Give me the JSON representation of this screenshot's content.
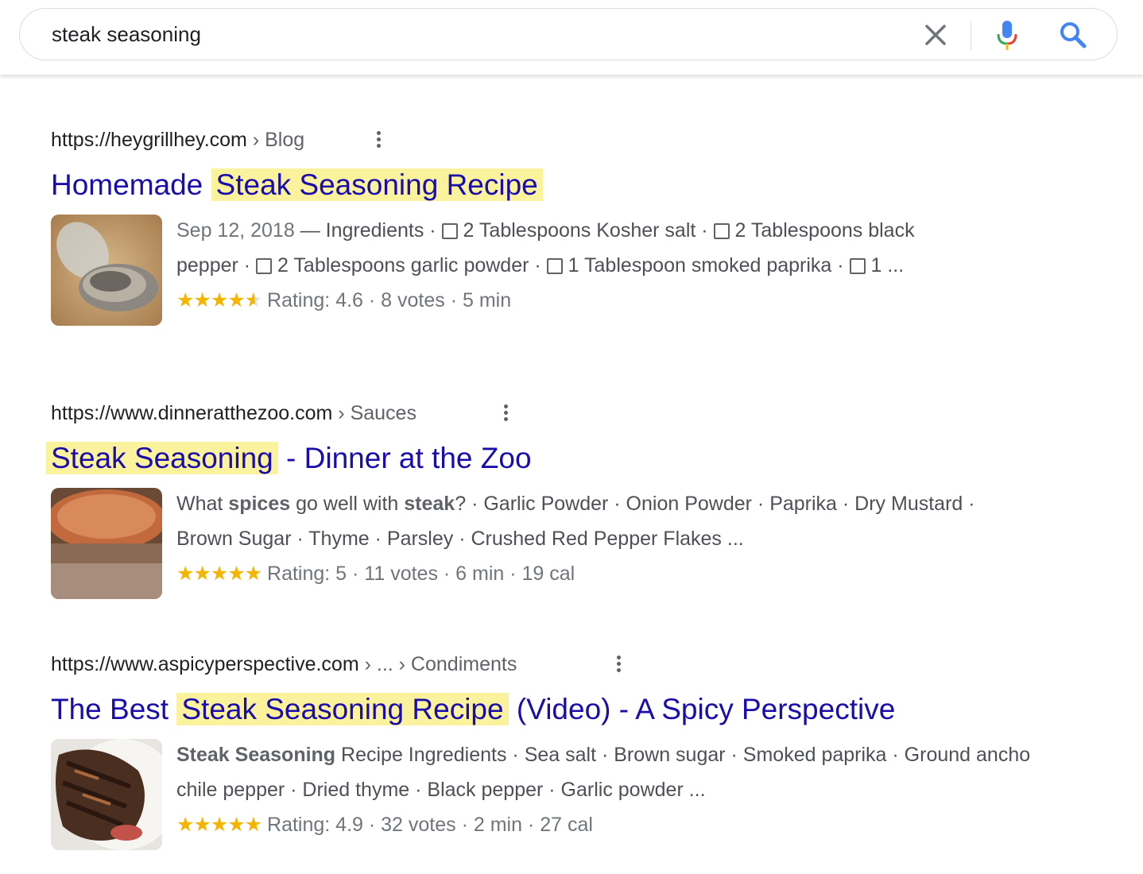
{
  "search": {
    "query": "steak seasoning"
  },
  "results": [
    {
      "url": "https://heygrillhey.com",
      "path": " › Blog",
      "title_pre": "Homemade ",
      "title_hl": "Steak Seasoning Recipe",
      "title_post": "",
      "snippet_line1": {
        "date": "Sep 12, 2018",
        "sep": " — ",
        "label": "Ingredients",
        "item1": "2 Tablespoons Kosher salt",
        "item2": "2 Tablespoons black"
      },
      "snippet_line2": {
        "item2_cont": "pepper",
        "item3": "2 Tablespoons garlic powder",
        "item4": "1 Tablespoon smoked paprika",
        "item5": "1 ..."
      },
      "stars": "★★★★",
      "star_partial": "★",
      "rating_text": "Rating: 4.6 · 8 votes · 5 min",
      "rating_value": 4.6
    },
    {
      "url": "https://www.dinneratthezoo.com",
      "path": " › Sauces",
      "title_pre": "",
      "title_hl": "Steak Seasoning",
      "title_post": " - Dinner at the Zoo",
      "snippet_a": "What ",
      "snippet_b1": "spices",
      "snippet_c": " go well with ",
      "snippet_b2": "steak",
      "snippet_d": "? · Garlic Powder · Onion Powder · Paprika · Dry Mustard · Brown Sugar · Thyme · Parsley · Crushed Red Pepper Flakes ...",
      "stars": "★★★★★",
      "rating_text": "Rating: 5 · 11 votes · 6 min · 19 cal",
      "rating_value": 5
    },
    {
      "url": "https://www.aspicyperspective.com",
      "path": " › ... › Condiments",
      "title_pre": "The Best ",
      "title_hl": "Steak Seasoning Recipe",
      "title_post": " (Video) - A Spicy Perspective",
      "snippet_b": "Steak Seasoning",
      "snippet_rest": " Recipe Ingredients · Sea salt · Brown sugar · Smoked paprika · Ground ancho chile pepper · Dried thyme · Black pepper · Garlic powder ...",
      "stars": "★★★★★",
      "rating_text": "Rating: 4.9 · 32 votes · 2 min · 27 cal",
      "rating_value": 4.9
    }
  ],
  "icons": {
    "clear": "close-icon",
    "mic": "mic-icon",
    "search": "search-icon",
    "more": "more-vert-icon"
  },
  "colors": {
    "link": "#1a0dab",
    "highlight": "#fbf29e",
    "star": "#f4b400",
    "search_blue": "#4285f4"
  }
}
